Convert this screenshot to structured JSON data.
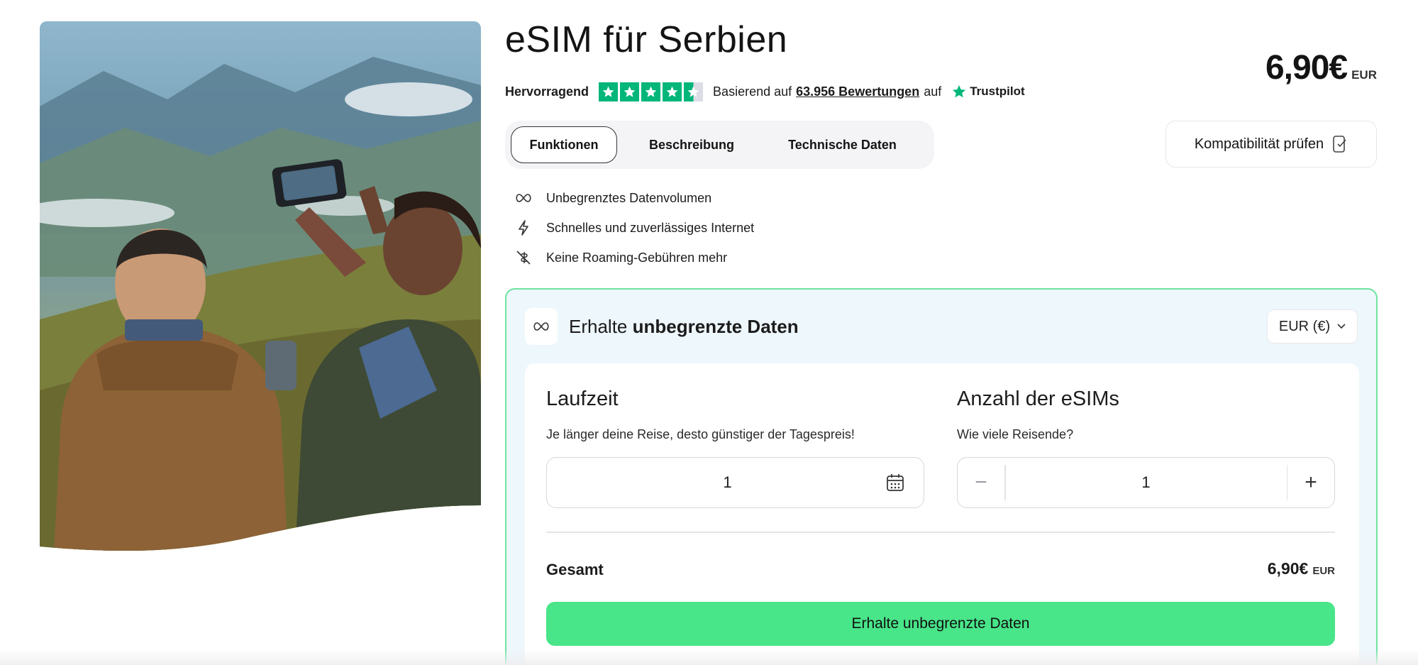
{
  "product": {
    "title": "eSIM für Serbien",
    "price_amount": "6,90€",
    "price_currency": "EUR"
  },
  "rating": {
    "label": "Hervorragend",
    "stars": 4.5,
    "based_on_text": "Basierend auf",
    "reviews_count": "63.956 Bewertungen",
    "on_text": "auf",
    "provider": "Trustpilot",
    "brand_color": "#00b67a"
  },
  "tabs": [
    {
      "label": "Funktionen",
      "active": true
    },
    {
      "label": "Beschreibung",
      "active": false
    },
    {
      "label": "Technische Daten",
      "active": false
    }
  ],
  "compatibility_button": {
    "label": "Kompatibilität prüfen",
    "icon": "phone-check-icon"
  },
  "features": [
    {
      "icon": "infinity-icon",
      "text": "Unbegrenztes Datenvolumen"
    },
    {
      "icon": "lightning-icon",
      "text": "Schnelles und zuverlässiges Internet"
    },
    {
      "icon": "no-roaming-icon",
      "text": "Keine Roaming-Gebühren mehr"
    }
  ],
  "plan_card": {
    "title_prefix": "Erhalte",
    "title_bold": "unbegrenzte Daten",
    "currency_select": "EUR (€)",
    "accent_border": "#6fe3a0",
    "background": "#eef7fc",
    "duration": {
      "title": "Laufzeit",
      "subtitle": "Je länger deine Reise, desto günstiger der Tagespreis!",
      "value": "1"
    },
    "quantity": {
      "title": "Anzahl der eSIMs",
      "subtitle": "Wie viele Reisende?",
      "value": "1",
      "minus": "−",
      "plus": "+"
    },
    "total": {
      "label": "Gesamt",
      "amount": "6,90€",
      "currency": "EUR"
    },
    "cta_label": "Erhalte unbegrenzte Daten",
    "cta_color": "#48e589"
  }
}
